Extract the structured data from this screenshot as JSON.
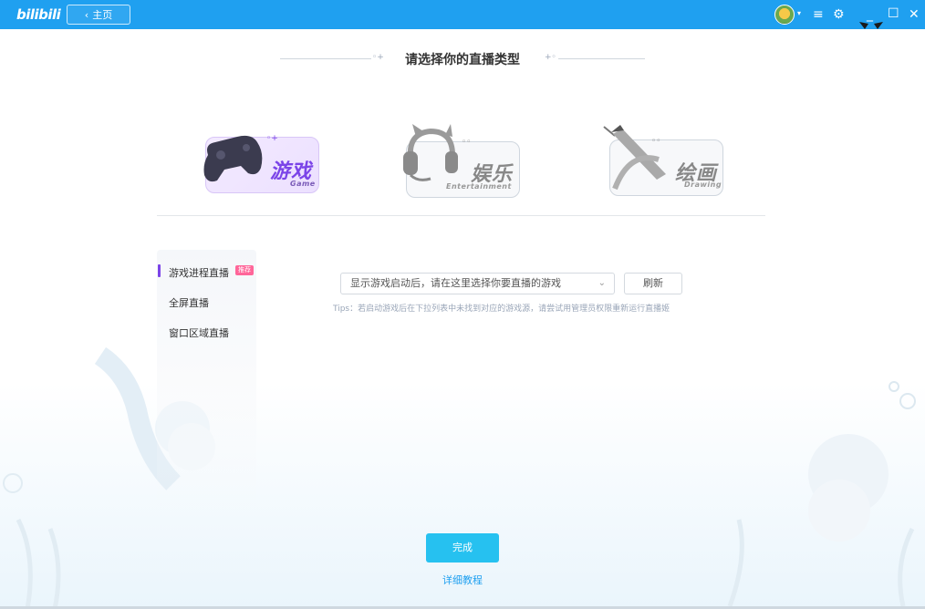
{
  "app": {
    "logo": "bilibili",
    "home_label": "主页"
  },
  "header": {
    "title": "请选择你的直播类型"
  },
  "categories": [
    {
      "id": "game",
      "label": "游戏",
      "sub": "Game",
      "active": true
    },
    {
      "id": "entertainment",
      "label": "娱乐",
      "sub": "Entertainment",
      "active": false
    },
    {
      "id": "drawing",
      "label": "绘画",
      "sub": "Drawing",
      "active": false
    }
  ],
  "sidebar": {
    "items": [
      {
        "label": "游戏进程直播",
        "badge": "推荐",
        "active": true
      },
      {
        "label": "全屏直播",
        "active": false
      },
      {
        "label": "窗口区域直播",
        "active": false
      }
    ]
  },
  "game_select": {
    "placeholder": "显示游戏启动后，请在这里选择你要直播的游戏"
  },
  "refresh_label": "刷新",
  "tips": "Tips：若启动游戏后在下拉列表中未找到对应的游戏源，请尝试用管理员权限重新运行直播姬",
  "done_label": "完成",
  "tutorial_label": "详细教程",
  "colors": {
    "titlebar": "#1fa0f0",
    "accent": "#7b44e8",
    "done": "#26c1f0",
    "badge": "#ff6699"
  },
  "icons": [
    "chevron-left-icon",
    "avatar",
    "menu-icon",
    "settings-icon",
    "minimize-icon",
    "maximize-icon",
    "close-icon",
    "gamepad-icon",
    "cat-headphones-icon",
    "pen-icon",
    "chevron-down-icon"
  ]
}
